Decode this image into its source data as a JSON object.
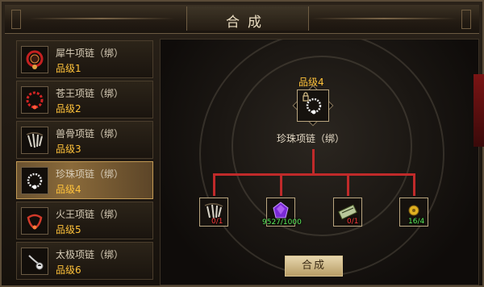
{
  "window": {
    "title": "合成"
  },
  "colors": {
    "grade_text": "#ffc23a",
    "selected_bg": "#8a6a3a",
    "connector_red": "#c02a2a",
    "count_red": "#ff3b3b",
    "count_green": "#5cf05c"
  },
  "sidebar": {
    "items": [
      {
        "name": "犀牛项链（绑）",
        "grade": "品级1",
        "icon": "rhino-necklace-icon",
        "selected": false
      },
      {
        "name": "苍王项链（绑）",
        "grade": "品级2",
        "icon": "canglang-necklace-icon",
        "selected": false
      },
      {
        "name": "兽骨项链（绑）",
        "grade": "品级3",
        "icon": "bone-necklace-icon",
        "selected": false
      },
      {
        "name": "珍珠项链（绑）",
        "grade": "品级4",
        "icon": "pearl-necklace-icon",
        "selected": true
      },
      {
        "name": "火王项链（绑）",
        "grade": "品级5",
        "icon": "fire-king-necklace-icon",
        "selected": false
      },
      {
        "name": "太极项链（绑）",
        "grade": "品级6",
        "icon": "taiji-necklace-icon",
        "selected": false
      }
    ]
  },
  "target": {
    "grade": "品级4",
    "name": "珍珠项链（绑）",
    "icon": "pearl-necklace-icon"
  },
  "materials": [
    {
      "icon": "bone-necklace-icon",
      "count": "0/1",
      "color": "red"
    },
    {
      "icon": "purple-gem-icon",
      "count": "9527/1000",
      "color": "green"
    },
    {
      "icon": "scroll-icon",
      "count": "0/1",
      "color": "red"
    },
    {
      "icon": "gold-coin-icon",
      "count": "16/4",
      "color": "green"
    }
  ],
  "craft_button": {
    "label": "合成"
  }
}
